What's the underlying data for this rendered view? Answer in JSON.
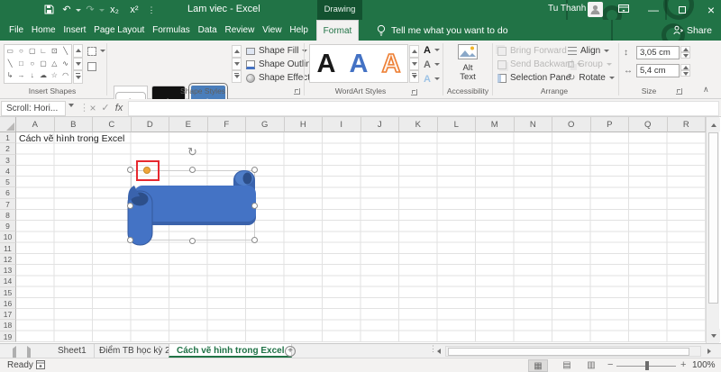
{
  "titlebar": {
    "title": "Lam viec - Excel",
    "contextual_label": "Drawing Tools",
    "user_name": "Tu Thanh"
  },
  "icons": {
    "undo": "↶",
    "redo": "↷",
    "subscript": "x₂",
    "superscript": "x²",
    "qat_more": "⋮",
    "minimize": "—",
    "close": "×",
    "cancel": "×",
    "check": "✓",
    "rotate": "↻",
    "height": "↕",
    "width": "↔",
    "collapse_ribbon": "∧",
    "view_normal": "▦",
    "view_layout": "▤",
    "view_break": "▥",
    "add_sheet": "+",
    "resize_dots": "⋮"
  },
  "ribbon_tabs": {
    "items": [
      "File",
      "Home",
      "Insert",
      "Page Layout",
      "Formulas",
      "Data",
      "Review",
      "View",
      "Help"
    ],
    "active_tab": "Format",
    "tell_me": "Tell me what you want to do",
    "share": "Share"
  },
  "ribbon": {
    "insert_shapes": {
      "label": "Insert Shapes",
      "glyphs": [
        "▭",
        "○",
        "▢",
        "∟",
        "⊡",
        "╲",
        "╲",
        "□",
        "○",
        "▢",
        "△",
        "∿",
        "↳",
        "→",
        "↓",
        "☁",
        "☆",
        "◠"
      ]
    },
    "shape_styles": {
      "label": "Shape Styles",
      "preview_1": "Abc",
      "preview_2": "Abc",
      "preview_3": "Abc",
      "fill": "Shape Fill",
      "outline": "Shape Outline",
      "effects": "Shape Effects"
    },
    "wordart": {
      "label": "WordArt Styles",
      "letter_1": "A",
      "letter_2": "A",
      "letter_3": "A",
      "mini_a": "A"
    },
    "accessibility": {
      "label": "Accessibility",
      "alt_text_line1": "Alt",
      "alt_text_line2": "Text"
    },
    "arrange": {
      "label": "Arrange",
      "bring_forward": "Bring Forward",
      "send_backward": "Send Backward",
      "selection_pane": "Selection Pane",
      "align": "Align",
      "group": "Group",
      "rotate": "Rotate"
    },
    "size": {
      "label": "Size",
      "height_value": "3,05 cm",
      "width_value": "5,4 cm"
    }
  },
  "formula_bar": {
    "name_box": "Scroll: Hori...",
    "fx": "fx",
    "formula_value": ""
  },
  "grid": {
    "columns": [
      "A",
      "B",
      "C",
      "D",
      "E",
      "F",
      "G",
      "H",
      "I",
      "J",
      "K",
      "L",
      "M",
      "N",
      "O",
      "P",
      "Q",
      "R"
    ],
    "rows": [
      "1",
      "2",
      "3",
      "4",
      "5",
      "6",
      "7",
      "8",
      "9",
      "10",
      "11",
      "12",
      "13",
      "14",
      "15",
      "16",
      "17",
      "18",
      "19"
    ],
    "a1_text": "Cách vẽ hình trong Excel"
  },
  "drawing": {
    "shape_name": "horizontal-scroll-shape",
    "fill_color": "#4473c5",
    "dark_color": "#2d4f8a",
    "annotation_color": "#e7292f",
    "adjust_handle_color": "#f0a63c"
  },
  "sheet_tabs": {
    "tabs": [
      {
        "label": "Sheet1",
        "active": false
      },
      {
        "label": "Điểm TB học kỳ 2",
        "active": false
      },
      {
        "label": "Cách vẽ hình trong Excel",
        "active": true
      }
    ]
  },
  "status_bar": {
    "ready": "Ready",
    "zoom_level": "100%"
  }
}
